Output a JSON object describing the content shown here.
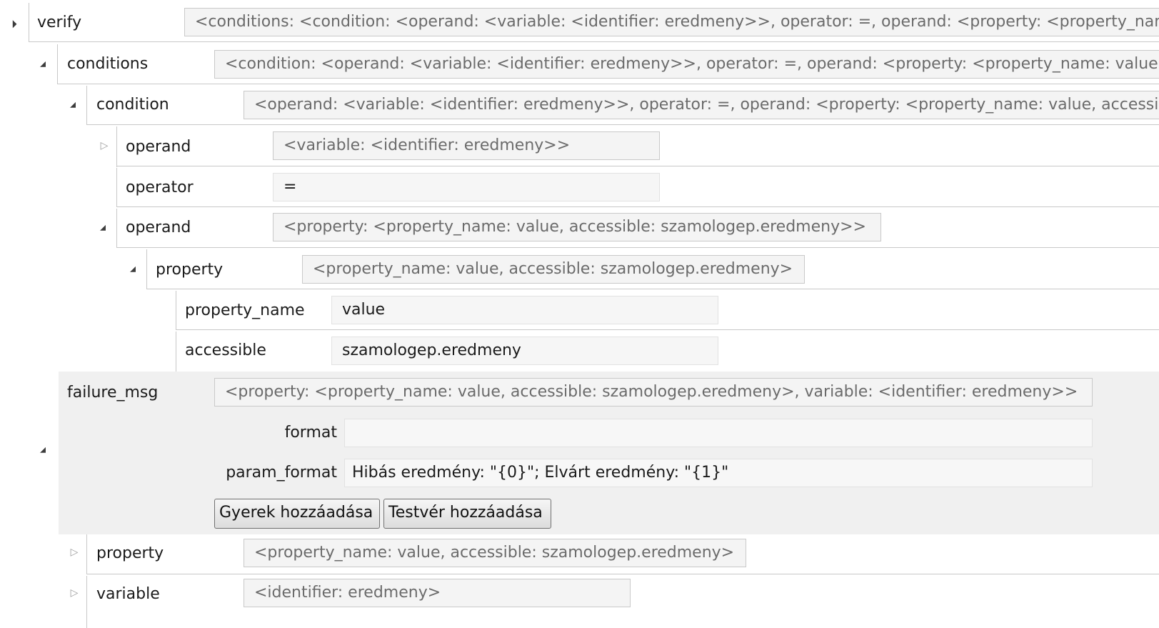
{
  "tree": {
    "verify": {
      "label": "verify",
      "summary": "<conditions: <condition: <operand: <variable: <identifier: eredmeny>>, operator: =, operand: <property: <property_name: value, accessible: szamologep.eredmeny>>>, failure_msg: <property: <property_name: value, accessible: szamologep.eredmeny>, variable: <identifier: eredmeny>>>>"
    },
    "conditions": {
      "label": "conditions",
      "summary": "<condition: <operand: <variable: <identifier: eredmeny>>, operator: =, operand: <property: <property_name: value, accessible: szamologep.eredmeny>>>>"
    },
    "condition": {
      "label": "condition",
      "summary": "<operand: <variable: <identifier: eredmeny>>, operator: =, operand: <property: <property_name: value, accessible: szamologep.eredmeny>>>"
    },
    "operand1": {
      "label": "operand",
      "summary": "<variable: <identifier: eredmeny>>"
    },
    "operator": {
      "label": "operator",
      "value": "="
    },
    "operand2": {
      "label": "operand",
      "summary": "<property: <property_name: value, accessible: szamologep.eredmeny>>"
    },
    "property_inner": {
      "label": "property",
      "summary": "<property_name: value, accessible: szamologep.eredmeny>"
    },
    "property_name": {
      "label": "property_name",
      "value": "value"
    },
    "accessible": {
      "label": "accessible",
      "value": "szamologep.eredmeny"
    },
    "failure_msg": {
      "label": "failure_msg",
      "summary": "<property: <property_name: value, accessible: szamologep.eredmeny>, variable: <identifier: eredmeny>>",
      "format_label": "format",
      "format_value": "",
      "param_format_label": "param_format",
      "param_format_value": "Hibás eredmény: \"{0}\"; Elvárt eredmény: \"{1}\"",
      "add_child_button": "Gyerek hozzáadása",
      "add_sibling_button": "Testvér hozzáadása"
    },
    "property_outer": {
      "label": "property",
      "summary": "<property_name: value, accessible: szamologep.eredmeny>"
    },
    "variable": {
      "label": "variable",
      "summary": "<identifier: eredmeny>"
    }
  },
  "icons": {
    "expanded": "▲",
    "collapsed": "▷"
  },
  "colors": {
    "panel_bg": "#f0f0f0",
    "summary_text": "#6b6b6b",
    "border": "#c9c9c9"
  }
}
